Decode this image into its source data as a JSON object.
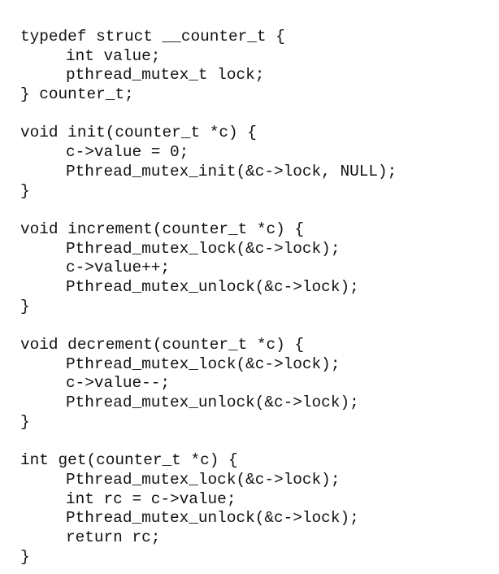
{
  "code": {
    "struct_block": [
      "typedef struct __counter_t {",
      "int value;",
      "pthread_mutex_t lock;",
      "} counter_t;"
    ],
    "init_block": [
      "void init(counter_t *c) {",
      "c->value = 0;",
      "Pthread_mutex_init(&c->lock, NULL);",
      "}"
    ],
    "increment_block": [
      "void increment(counter_t *c) {",
      "Pthread_mutex_lock(&c->lock);",
      "c->value++;",
      "Pthread_mutex_unlock(&c->lock);",
      "}"
    ],
    "decrement_block": [
      "void decrement(counter_t *c) {",
      "Pthread_mutex_lock(&c->lock);",
      "c->value--;",
      "Pthread_mutex_unlock(&c->lock);",
      "}"
    ],
    "get_block": [
      "int get(counter_t *c) {",
      "Pthread_mutex_lock(&c->lock);",
      "int rc = c->value;",
      "Pthread_mutex_unlock(&c->lock);",
      "return rc;",
      "}"
    ]
  }
}
